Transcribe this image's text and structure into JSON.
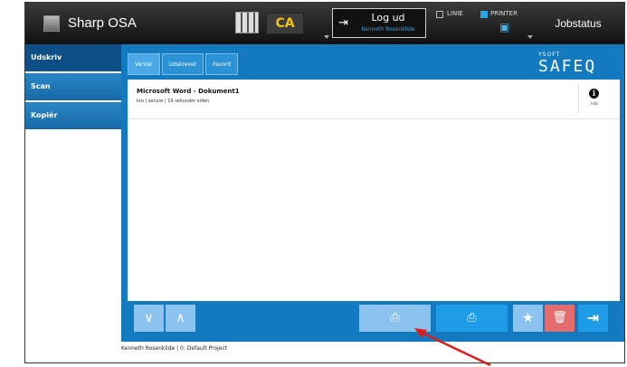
{
  "header": {
    "app_title": "Sharp OSA",
    "ca_label": "CA",
    "logout": {
      "label": "Log ud",
      "user": "Kenneth Rosenklide"
    },
    "linie_label": "LINIE",
    "printer_label": "PRINTER",
    "jobstatus_label": "Jobstatus"
  },
  "sidebar": {
    "items": [
      {
        "label": "Udskriv",
        "active": true
      },
      {
        "label": "Scan",
        "active": false
      },
      {
        "label": "Kopiér",
        "active": false
      }
    ]
  },
  "main": {
    "tabs": [
      {
        "label": "Venter",
        "active": true
      },
      {
        "label": "Udskrevet",
        "active": false
      },
      {
        "label": "Favorit",
        "active": false
      }
    ],
    "brand": {
      "sub": "YSOFT",
      "main": "SAFEQ"
    },
    "jobs": [
      {
        "title": "Microsoft Word - Dokument1",
        "meta": "kro | secure | 19 sekunder siden",
        "info_label": "Info"
      }
    ]
  },
  "status_bar": {
    "text": "Kenneth Rosenklide  | 0: Default Project"
  },
  "colors": {
    "accent_blue": "#137ac0",
    "button_light": "#8cc3ee",
    "button_active": "#1e9ce8",
    "delete_red": "#e46c6c",
    "annotation_arrow": "#e01b1b"
  },
  "icons": {
    "app": "sharp-app-icon",
    "keypad": "keypad-icon",
    "logout": "logout-icon",
    "printer_status": "printer-status-icon",
    "info": "info-icon",
    "down": "chevron-down-icon",
    "up": "chevron-up-icon",
    "print": "print-icon",
    "release": "print-release-icon",
    "favorite": "star-icon",
    "delete": "trash-icon",
    "exit": "exit-icon"
  }
}
